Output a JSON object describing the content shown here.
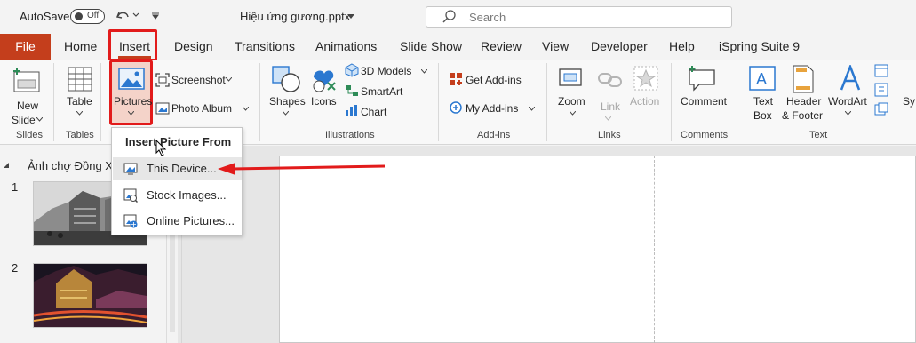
{
  "titlebar": {
    "autosave_label": "AutoSave",
    "autosave_state": "Off",
    "document_title": "Hiệu ứng gương.pptx",
    "search_placeholder": "Search"
  },
  "tabs": [
    {
      "label": "File"
    },
    {
      "label": "Home"
    },
    {
      "label": "Insert"
    },
    {
      "label": "Design"
    },
    {
      "label": "Transitions"
    },
    {
      "label": "Animations"
    },
    {
      "label": "Slide Show"
    },
    {
      "label": "Review"
    },
    {
      "label": "View"
    },
    {
      "label": "Developer"
    },
    {
      "label": "Help"
    },
    {
      "label": "iSpring Suite 9"
    }
  ],
  "ribbon": {
    "slides": {
      "group": "Slides",
      "new_slide_1": "New",
      "new_slide_2": "Slide"
    },
    "tables": {
      "group": "Tables",
      "table": "Table"
    },
    "images": {
      "pictures": "Pictures",
      "screenshot": "Screenshot",
      "photo_album": "Photo Album"
    },
    "illustrations": {
      "group": "Illustrations",
      "shapes": "Shapes",
      "icons": "Icons",
      "models": "3D Models",
      "smartart": "SmartArt",
      "chart": "Chart"
    },
    "addins": {
      "group": "Add-ins",
      "get": "Get Add-ins",
      "my": "My Add-ins"
    },
    "links": {
      "group": "Links",
      "zoom": "Zoom",
      "link": "Link",
      "action": "Action"
    },
    "comments": {
      "group": "Comments",
      "comment": "Comment"
    },
    "text": {
      "group": "Text",
      "textbox_1": "Text",
      "textbox_2": "Box",
      "header_1": "Header",
      "header_2": "& Footer",
      "wordart": "WordArt",
      "sy": "Sy"
    }
  },
  "dropdown": {
    "heading": "Insert Picture From",
    "items": [
      {
        "label": "This Device..."
      },
      {
        "label": "Stock Images..."
      },
      {
        "label": "Online Pictures..."
      }
    ]
  },
  "slides_panel": {
    "section": "Ảnh chợ Đồng Xuân",
    "slides": [
      {
        "number": "1"
      },
      {
        "number": "2"
      }
    ]
  },
  "colors": {
    "accent": "#c43e1c",
    "highlight_border": "#e21b1b",
    "arrow": "#e21b1b"
  }
}
